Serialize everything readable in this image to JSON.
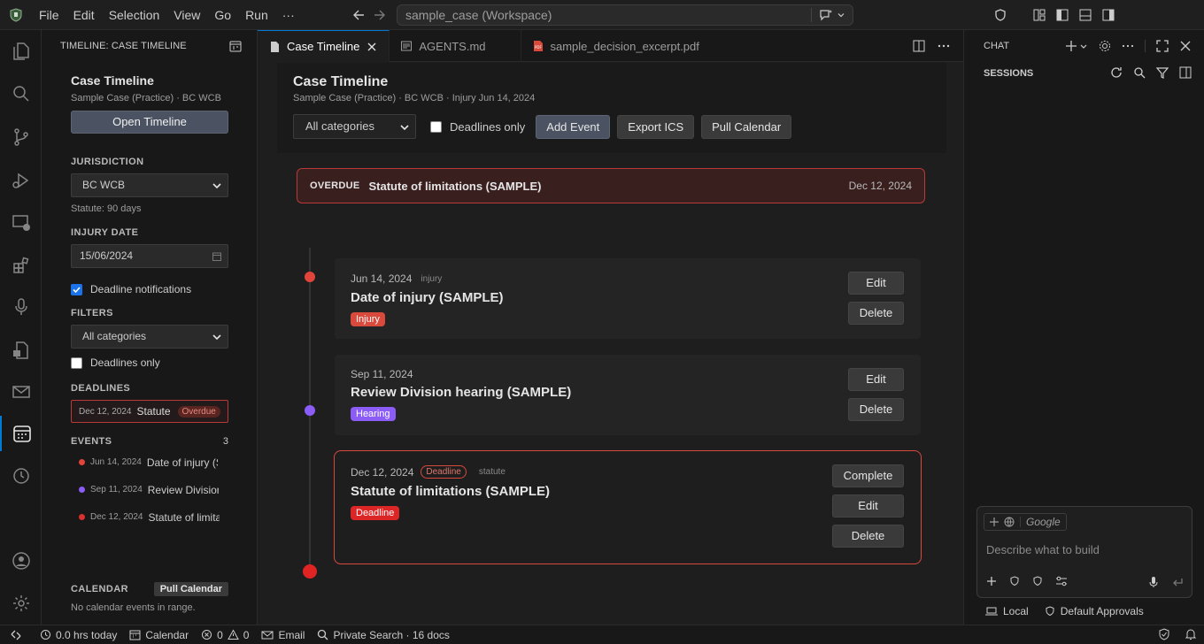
{
  "menu": [
    "File",
    "Edit",
    "Selection",
    "View",
    "Go",
    "Run",
    "···"
  ],
  "search": {
    "text": "sample_case (Workspace)"
  },
  "tabs": [
    {
      "label": "Case Timeline",
      "icon": "file-icon"
    },
    {
      "label": "AGENTS.md",
      "icon": "markdown-icon"
    },
    {
      "label": "sample_decision_excerpt.pdf",
      "icon": "pdf-icon"
    }
  ],
  "sidebar": {
    "header": "TIMELINE: CASE TIMELINE",
    "title": "Case Timeline",
    "subtitle": "Sample Case (Practice) · BC WCB",
    "open_button": "Open Timeline",
    "jurisdiction_label": "JURISDICTION",
    "jurisdiction_value": "BC WCB",
    "statute_note": "Statute: 90 days",
    "injury_label": "INJURY DATE",
    "injury_value": "15/06/2024",
    "notif_label": "Deadline notifications",
    "filters_label": "FILTERS",
    "filter_value": "All categories",
    "deadlines_only": "Deadlines only",
    "deadlines_label": "DEADLINES",
    "deadline_item": {
      "date": "Dec 12, 2024",
      "name": "Statute of limitations (SAMPLE)",
      "status": "Overdue"
    },
    "events_label": "EVENTS",
    "events_count": "3",
    "events": [
      {
        "date": "Jun 14, 2024",
        "name": "Date of injury (SAMPLE)",
        "color": "#e0443b"
      },
      {
        "date": "Sep 11, 2024",
        "name": "Review Division hearing (SAMPLE)",
        "color": "#8b5cf6"
      },
      {
        "date": "Dec 12, 2024",
        "name": "Statute of limitations (SAMPLE)",
        "color": "#d93030"
      }
    ],
    "calendar_label": "CALENDAR",
    "calendar_button": "Pull Calendar",
    "calendar_note": "No calendar events in range."
  },
  "main": {
    "title": "Case Timeline",
    "subtitle": "Sample Case (Practice) · BC WCB · Injury Jun 14, 2024",
    "category_select": "All categories",
    "deadlines_only": "Deadlines only",
    "add_event": "Add Event",
    "export_ics": "Export ICS",
    "pull_calendar": "Pull Calendar",
    "overdue": {
      "label": "OVERDUE",
      "title": "Statute of limitations (SAMPLE)",
      "date": "Dec 12, 2024"
    },
    "events": [
      {
        "date": "Jun 14, 2024",
        "category": "injury",
        "title": "Date of injury (SAMPLE)",
        "badge": "Injury",
        "badge_color": "#d9493c",
        "dot_color": "#e0443b",
        "edit": "Edit",
        "delete": "Delete"
      },
      {
        "date": "Sep 11, 2024",
        "category": "",
        "title": "Review Division hearing (SAMPLE)",
        "badge": "Hearing",
        "badge_color": "#8b5cf6",
        "dot_color": "#8b5cf6",
        "edit": "Edit",
        "delete": "Delete"
      },
      {
        "date": "Dec 12, 2024",
        "flag": "Deadline",
        "category": "statute",
        "title": "Statute of limitations (SAMPLE)",
        "badge": "Deadline",
        "badge_color": "#dc2626",
        "dot_color": "#e02424",
        "complete": "Complete",
        "edit": "Edit",
        "delete": "Delete"
      }
    ]
  },
  "chat": {
    "title": "CHAT",
    "sessions": "SESSIONS",
    "context_label": "Google",
    "placeholder": "Describe what to build",
    "local": "Local",
    "approvals": "Default Approvals"
  },
  "status": {
    "hours": "0.0 hrs today",
    "calendar": "Calendar",
    "errors": "0",
    "warnings": "0",
    "email": "Email",
    "search": "Private Search · 16 docs"
  },
  "colors": {
    "accent": "#0078d4",
    "danger": "#d9493c",
    "purple": "#8b5cf6"
  }
}
